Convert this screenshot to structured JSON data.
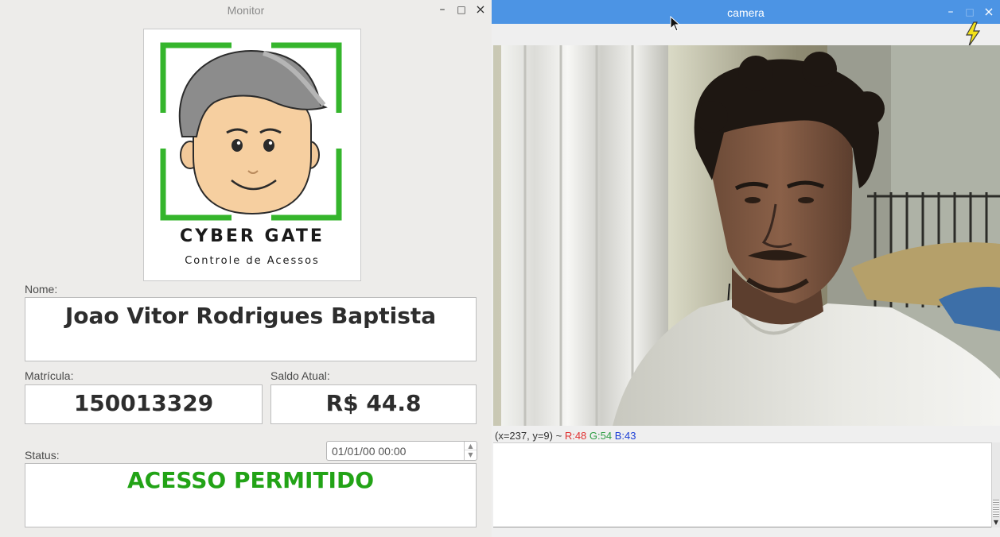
{
  "monitor": {
    "title": "Monitor",
    "controls": {
      "minimize": "–",
      "maximize": "□",
      "close": "×"
    },
    "logo": {
      "brand": "CYBER GATE",
      "tagline": "Controle de Acessos"
    },
    "nome": {
      "label": "Nome:",
      "value": "Joao Vitor Rodrigues Baptista"
    },
    "matricula": {
      "label": "Matrícula:",
      "value": "150013329"
    },
    "saldo": {
      "label": "Saldo Atual:",
      "value": "R$ 44.8"
    },
    "status": {
      "label": "Status:",
      "value": "ACESSO PERMITIDO",
      "color": "#22a316"
    },
    "datetime": "01/01/00 00:00"
  },
  "camera": {
    "title": "camera",
    "controls": {
      "minimize": "–",
      "maximize": "□",
      "close": "×"
    },
    "titlebar_color": "#4c94e4",
    "toolbar_icon": "lightning-icon",
    "pixel_readout": {
      "coords": "(x=237, y=9) ~",
      "r": "R:48",
      "g": "G:54",
      "b": "B:43"
    }
  }
}
